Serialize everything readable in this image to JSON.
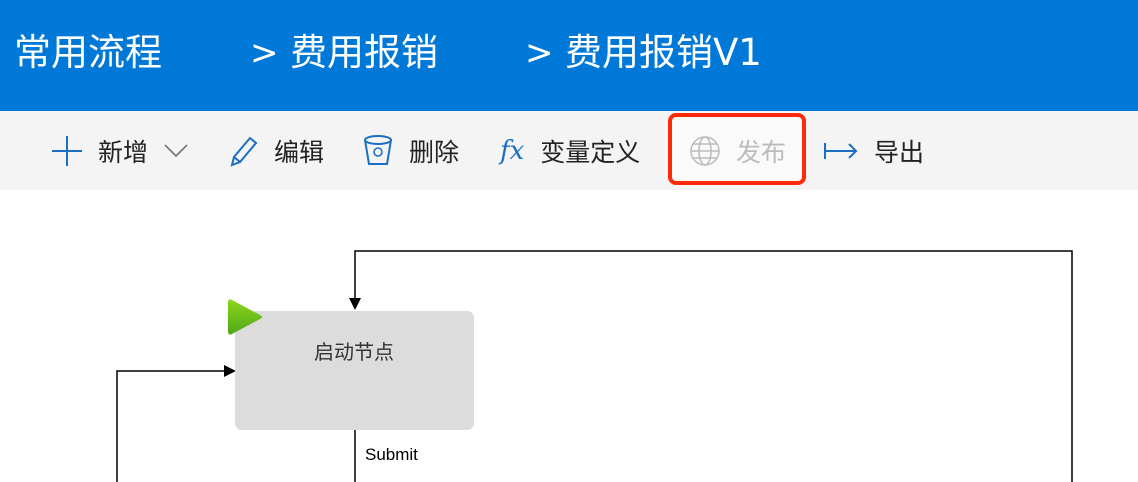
{
  "breadcrumb": [
    "常用流程",
    "费用报销",
    "费用报销V1"
  ],
  "breadcrumb_separator": ">",
  "toolbar": {
    "add": "新增",
    "edit": "编辑",
    "delete": "删除",
    "variables": "变量定义",
    "variables_icon_text": "fx",
    "publish": "发布",
    "export": "导出"
  },
  "diagram": {
    "start_node": "启动节点",
    "edge_label": "Submit"
  },
  "colors": {
    "header": "#0078d7",
    "accent": "#1a6fc4",
    "highlight": "#ff2a0a",
    "node": "#dcdcdc",
    "start": "#6cc417"
  }
}
